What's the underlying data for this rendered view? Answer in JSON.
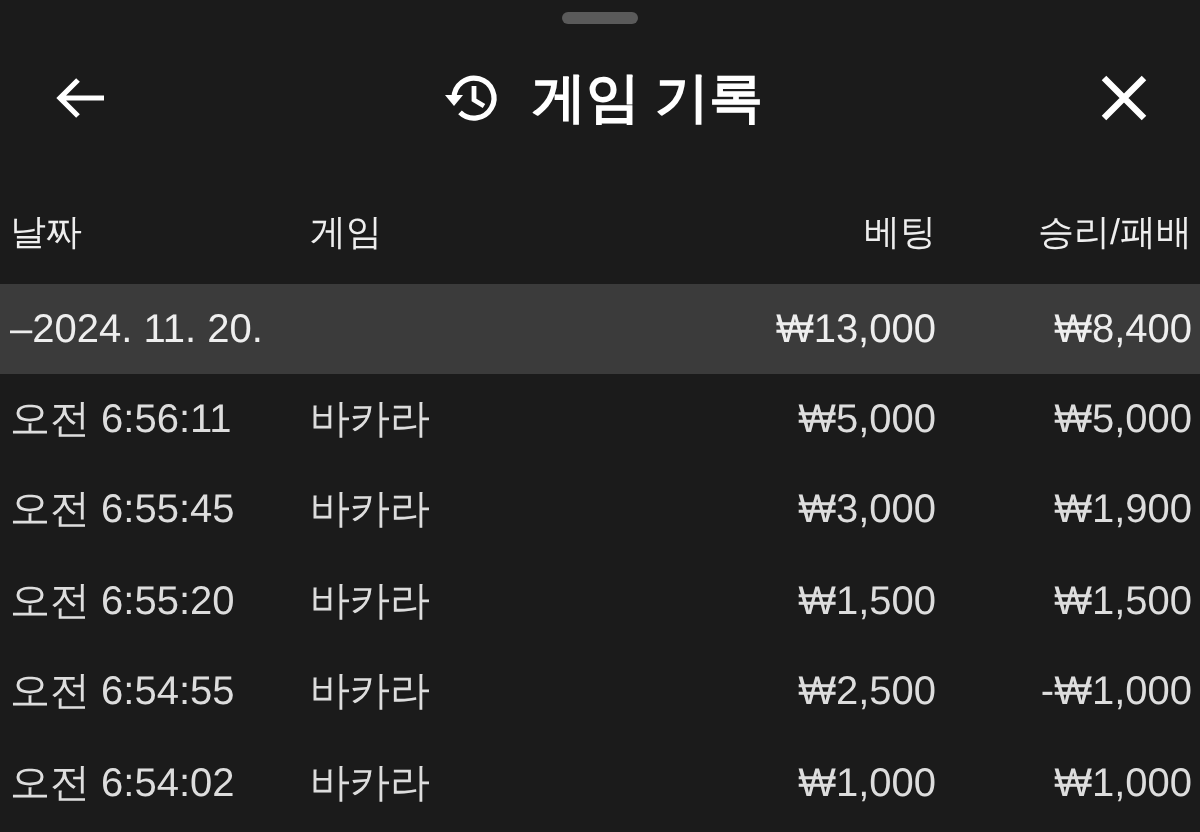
{
  "header": {
    "title": "게임 기록"
  },
  "table": {
    "columns": [
      "날짜",
      "게임",
      "베팅",
      "승리/패배"
    ],
    "rows": [
      {
        "kind": "group",
        "cells": [
          "–2024. 11. 20.",
          "",
          "₩13,000",
          "₩8,400"
        ]
      },
      {
        "kind": "entry",
        "cells": [
          "오전 6:56:11",
          "바카라",
          "₩5,000",
          "₩5,000"
        ]
      },
      {
        "kind": "entry",
        "cells": [
          "오전 6:55:45",
          "바카라",
          "₩3,000",
          "₩1,900"
        ]
      },
      {
        "kind": "entry",
        "cells": [
          "오전 6:55:20",
          "바카라",
          "₩1,500",
          "₩1,500"
        ]
      },
      {
        "kind": "entry",
        "cells": [
          "오전 6:54:55",
          "바카라",
          "₩2,500",
          "-₩1,000"
        ]
      },
      {
        "kind": "entry",
        "cells": [
          "오전 6:54:02",
          "바카라",
          "₩1,000",
          "₩1,000"
        ]
      }
    ]
  }
}
